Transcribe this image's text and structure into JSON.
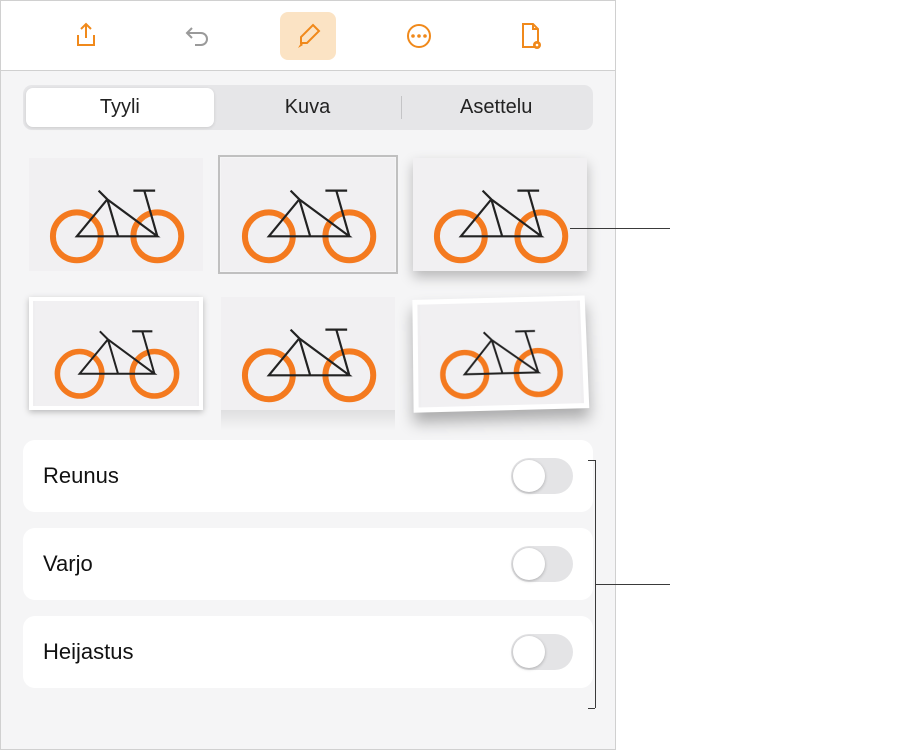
{
  "toolbar": {
    "icons": [
      "share-icon",
      "undo-icon",
      "brush-icon",
      "more-icon",
      "document-icon"
    ],
    "active_index": 2
  },
  "tabs": {
    "items": [
      {
        "label": "Tyyli"
      },
      {
        "label": "Kuva"
      },
      {
        "label": "Asettelu"
      }
    ],
    "selected_index": 0
  },
  "style_presets": {
    "count": 6,
    "selected_index": 1
  },
  "options": [
    {
      "label": "Reunus",
      "on": false
    },
    {
      "label": "Varjo",
      "on": false
    },
    {
      "label": "Heijastus",
      "on": false
    }
  ]
}
